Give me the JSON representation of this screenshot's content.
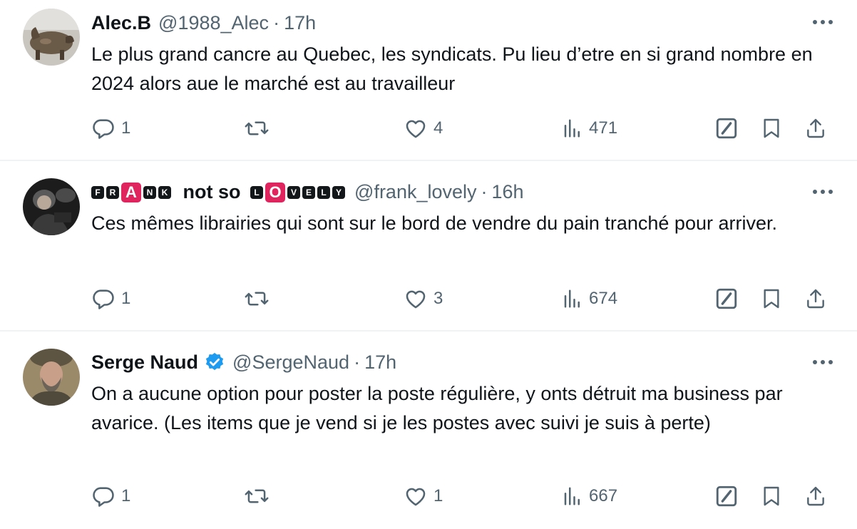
{
  "tweets": [
    {
      "name": "Alec.B",
      "handle": "@1988_Alec",
      "sep": "·",
      "time": "17h",
      "text": "Le plus grand cancre au Quebec, les syndicats. Pu lieu d’etre en si grand nombre en 2024 alors aue le marché est au travailleur",
      "replies": "1",
      "retweets": "",
      "likes": "4",
      "views": "471"
    },
    {
      "name_letters": [
        "F",
        "R",
        "A",
        "N",
        "K"
      ],
      "name_mid": "not so",
      "name_letters2": [
        "L",
        "O",
        "V",
        "E",
        "L",
        "Y"
      ],
      "handle": "@frank_lovely",
      "sep": "·",
      "time": "16h",
      "text": "Ces mêmes librairies qui sont sur le bord de vendre du pain tranché pour arriver.",
      "replies": "1",
      "retweets": "",
      "likes": "3",
      "views": "674"
    },
    {
      "name": "Serge Naud",
      "verified": true,
      "handle": "@SergeNaud",
      "sep": "·",
      "time": "17h",
      "text": "On a aucune option pour poster la poste régulière, y onts détruit ma business par avarice. (Les items que je vend si je les postes avec suivi je suis à perte)",
      "replies": "1",
      "retweets": "",
      "likes": "1",
      "views": "667"
    }
  ],
  "colors": {
    "text": "#0f1419",
    "secondary": "#536471",
    "divider": "#eff3f4",
    "verified": "#1d9bf0",
    "accent_red": "#e0245e"
  },
  "icons": [
    "reply-icon",
    "retweet-icon",
    "like-icon",
    "views-icon",
    "grok-icon",
    "bookmark-icon",
    "share-icon",
    "more-icon",
    "verified-badge-icon"
  ]
}
